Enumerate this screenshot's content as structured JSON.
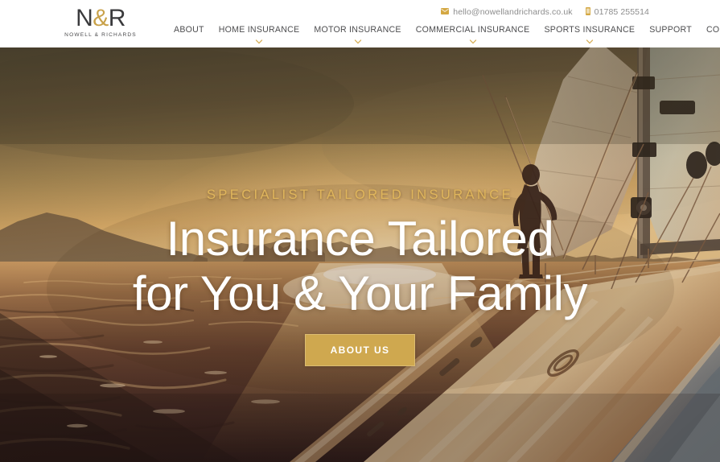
{
  "site": {
    "brand_gold": "#c9a24a",
    "nav_text_color": "#4d4d4f"
  },
  "header": {
    "logo": {
      "name": "N",
      "ampersand": "&",
      "surname": "R",
      "subtitle": "NOWELL & RICHARDS"
    },
    "contact": {
      "email_icon": "envelope-icon",
      "email": "hello@nowellandrichards.co.uk",
      "phone_icon": "mobile-phone-icon",
      "phone": "01785 255514"
    },
    "nav": [
      {
        "label": "ABOUT",
        "has_dropdown": false
      },
      {
        "label": "HOME INSURANCE",
        "has_dropdown": true
      },
      {
        "label": "MOTOR INSURANCE",
        "has_dropdown": true
      },
      {
        "label": "COMMERCIAL INSURANCE",
        "has_dropdown": true
      },
      {
        "label": "SPORTS INSURANCE",
        "has_dropdown": true
      },
      {
        "label": "SUPPORT",
        "has_dropdown": false
      },
      {
        "label": "CONTACT",
        "has_dropdown": false
      }
    ]
  },
  "hero": {
    "eyebrow": "SPECIALIST TAILORED INSURANCE",
    "headline_line1": "Insurance Tailored",
    "headline_line2": "for You & Your Family",
    "cta_label": "ABOUT US",
    "cta_color": "#cfa84f",
    "eyebrow_color": "#e0b65c",
    "image_description": "Sunset sailing scene: silhouetted person standing at the bow rail of a yacht under sail, warm orange sky over water with distant island hills"
  }
}
